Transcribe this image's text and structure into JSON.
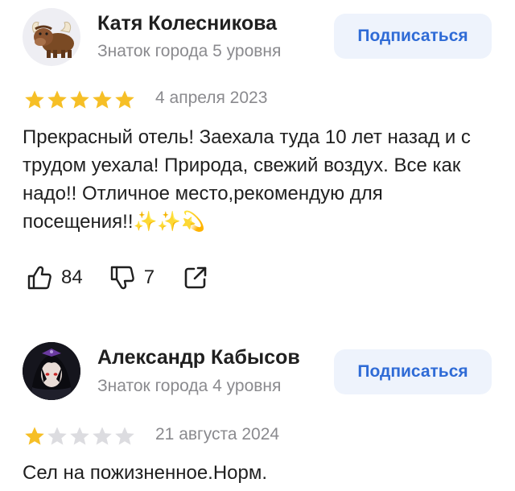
{
  "reviews": [
    {
      "author": "Катя Колесникова",
      "level": "Знаток города 5 уровня",
      "subscribe_label": "Подписаться",
      "rating": 5,
      "date": "4 апреля 2023",
      "text": "Прекрасный отель! Заехала туда 10 лет назад и с трудом уехала! Природа, свежий воздух. Все как надо!! Отличное место,рекомендую для посещения!!✨✨💫",
      "likes": "84",
      "dislikes": "7",
      "avatar": "yak-emoji-icon"
    },
    {
      "author": "Александр Кабысов",
      "level": "Знаток города 4 уровня",
      "subscribe_label": "Подписаться",
      "rating": 1,
      "date": "21 августа 2024",
      "text": "Сел на пожизненное.Норм.",
      "avatar": "anime-character-photo"
    }
  ],
  "colors": {
    "star_filled": "#f6bf26",
    "star_empty": "#dcdce0",
    "subscribe_bg": "#eef3fc",
    "subscribe_text": "#2f6bd6",
    "secondary_text": "#8a8a8e"
  },
  "icons": {
    "like": "thumbs-up-icon",
    "dislike": "thumbs-down-icon",
    "share": "share-icon"
  }
}
